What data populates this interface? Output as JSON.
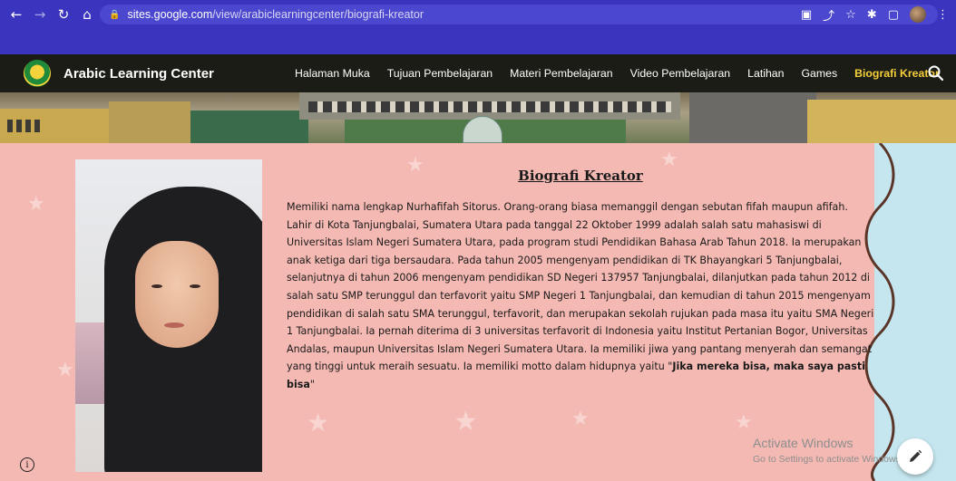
{
  "browser": {
    "url_host": "sites.google.com",
    "url_path": "/view/arabiclearningcenter/biografi-kreator"
  },
  "site": {
    "title": "Arabic Learning Center",
    "menu": [
      {
        "label": "Halaman Muka",
        "active": false
      },
      {
        "label": "Tujuan Pembelajaran",
        "active": false
      },
      {
        "label": "Materi Pembelajaran",
        "active": false
      },
      {
        "label": "Video Pembelajaran",
        "active": false
      },
      {
        "label": "Latihan",
        "active": false
      },
      {
        "label": "Games",
        "active": false
      },
      {
        "label": "Biografi Kreator",
        "active": true
      }
    ]
  },
  "content": {
    "heading": "Biografi Kreator",
    "bio": "Memiliki nama lengkap Nurhafifah Sitorus. Orang-orang biasa memanggil dengan sebutan fifah maupun afifah. Lahir di Kota Tanjungbalai, Sumatera Utara pada tanggal 22 Oktober 1999 adalah salah satu mahasiswi di Universitas Islam Negeri Sumatera Utara, pada program studi Pendidikan Bahasa Arab Tahun 2018. Ia merupakan anak ketiga dari tiga bersaudara. Pada tahun 2005 mengenyam pendidikan di TK Bhayangkari 5 Tanjungbalai, selanjutnya di tahun 2006 mengenyam pendidikan SD Negeri 137957 Tanjungbalai, dilanjutkan pada tahun 2012 di salah satu SMP terunggul dan terfavorit yaitu SMP Negeri 1 Tanjungbalai, dan kemudian di tahun 2015 mengenyam pendidikan di salah satu SMA terunggul, terfavorit, dan merupakan sekolah rujukan pada masa itu yaitu SMA Negeri 1 Tanjungbalai. Ia pernah diterima di 3 universitas terfavorit di Indonesia yaitu Institut Pertanian Bogor, Universitas Andalas, maupun Universitas Islam Negeri Sumatera Utara. Ia memiliki jiwa yang pantang menyerah dan semangat yang tinggi untuk meraih sesuatu. Ia memiliki motto dalam hidupnya yaitu \"",
    "motto": "Jika mereka bisa, maka saya pasti bisa",
    "quote_close": "\""
  },
  "watermark": {
    "title": "Activate Windows",
    "subtitle": "Go to Settings to activate Windows."
  },
  "colors": {
    "chrome": "#3a34bf",
    "header": "#1c1c16",
    "page_bg": "#f4b9b3",
    "active_menu": "#f4cf3a",
    "side_panel": "#c5e6ef"
  },
  "icons": {
    "back": "arrow-left",
    "forward": "arrow-right",
    "reload": "reload",
    "home": "home",
    "lock": "lock",
    "search": "search",
    "edit": "pencil",
    "info": "info"
  }
}
